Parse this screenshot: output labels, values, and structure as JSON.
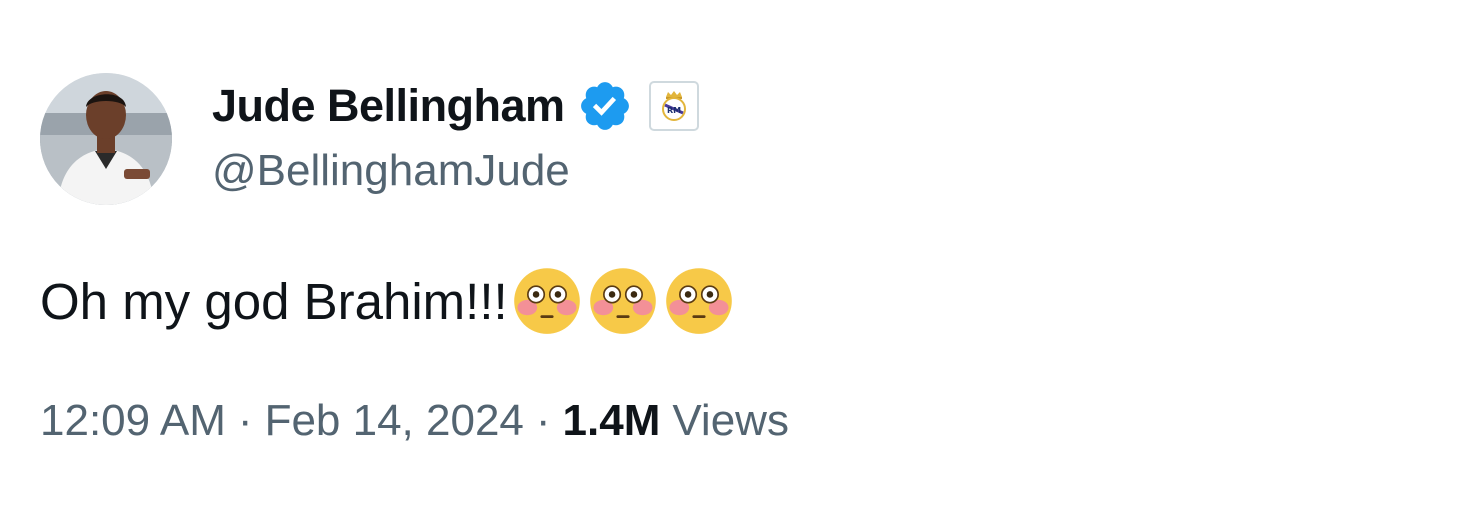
{
  "author": {
    "display_name": "Jude Bellingham",
    "handle": "@BellinghamJude",
    "verified_badge_color": "#1d9bf0",
    "verified_icon": "verified-badge-icon",
    "affiliation_icon": "real-madrid-crest-icon"
  },
  "tweet": {
    "text": "Oh my god Brahim!!!",
    "emojis": [
      "flushed-face",
      "flushed-face",
      "flushed-face"
    ]
  },
  "meta": {
    "time": "12:09 AM",
    "separator": "·",
    "date": "Feb 14, 2024",
    "views_count": "1.4M",
    "views_label": "Views"
  },
  "colors": {
    "text_primary": "#0f1419",
    "text_secondary": "#536471",
    "background": "#ffffff"
  }
}
